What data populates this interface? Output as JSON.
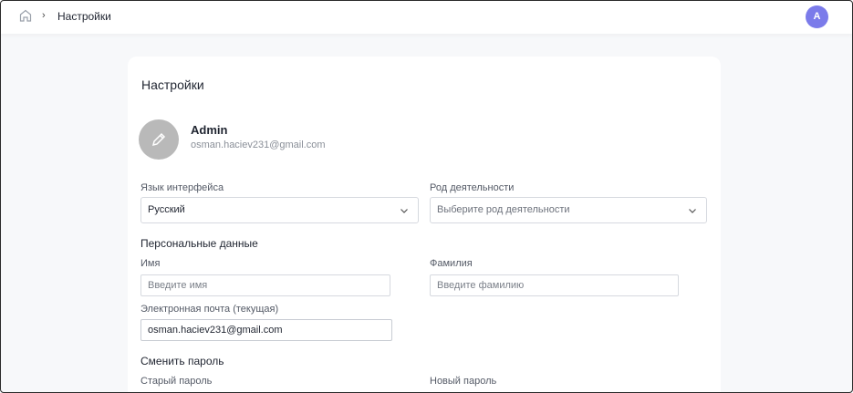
{
  "breadcrumb": {
    "separator": "›",
    "current": "Настройки"
  },
  "avatar": {
    "initial": "A",
    "color": "#7b7bea"
  },
  "page": {
    "title": "Настройки"
  },
  "profile": {
    "name": "Admin",
    "email": "osman.haciev231@gmail.com",
    "photo_icon": "pencil-icon"
  },
  "fields": {
    "language": {
      "label": "Язык интерфейса",
      "value": "Русский"
    },
    "activity": {
      "label": "Род деятельности",
      "placeholder": "Выберите род деятельности"
    },
    "personal_section": "Персональные данные",
    "first_name": {
      "label": "Имя",
      "placeholder": "Введите имя"
    },
    "last_name": {
      "label": "Фамилия",
      "placeholder": "Введите фамилию"
    },
    "email": {
      "label": "Электронная почта (текущая)",
      "value": "osman.haciev231@gmail.com"
    },
    "password_section": "Сменить пароль",
    "old_password": {
      "label": "Старый пароль"
    },
    "new_password": {
      "label": "Новый пароль"
    }
  }
}
